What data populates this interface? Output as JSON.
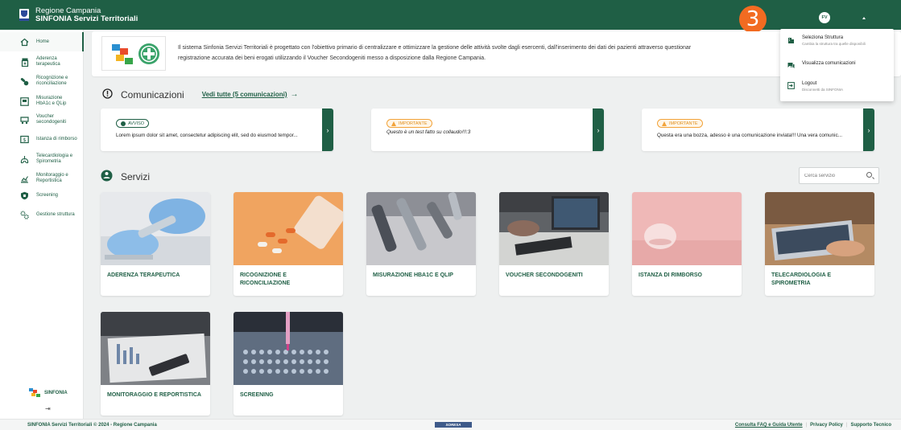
{
  "header": {
    "line1": "Regione Campania",
    "line2": "SINFONIA Servizi Territoriali",
    "step_number": "3",
    "avatar_initials": "FV"
  },
  "sidebar": {
    "items": [
      {
        "label": "Home",
        "icon": "home-icon"
      },
      {
        "label": "Aderenza terapeutica",
        "icon": "pill-bottle-icon"
      },
      {
        "label": "Ricognizione e riconciliazione",
        "icon": "pills-icon"
      },
      {
        "label": "Misurazione HbA1c e QLip",
        "icon": "meter-icon"
      },
      {
        "label": "Voucher secondogeniti",
        "icon": "stroller-icon"
      },
      {
        "label": "Istanza di rimborso",
        "icon": "money-icon"
      },
      {
        "label": "Telecardiologia e Spirometria",
        "icon": "lungs-icon"
      },
      {
        "label": "Monitoraggio e Reportistica",
        "icon": "chart-icon"
      },
      {
        "label": "Screening",
        "icon": "shield-icon"
      },
      {
        "label": "Gestione struttura",
        "icon": "gears-icon"
      }
    ],
    "logo_text": "SINFONIA",
    "collapse_icon": "collapse-icon"
  },
  "intro": {
    "text": "Il sistema Sinfonia Servizi Territoriali è progettato con l'obiettivo primario di centralizzare e ottimizzare la gestione delle attività svolte dagli esercenti, dall'inserimento dei dati dei pazienti attraverso questionar",
    "text2": "registrazione accurata dei beni erogati utilizzando il Voucher Secondogeniti messo a disposizione dalla Regione Campania."
  },
  "communications": {
    "title": "Comunicazioni",
    "see_all": "Vedi tutte (5 comunicazioni)",
    "cards": [
      {
        "badge": "AVVISO",
        "text": "Lorem ipsum dolor sit amet, consectetur adipiscing elit, sed do eiusmod tempor..."
      },
      {
        "badge": "IMPORTANTE",
        "text": "Questo è un test fatto su collaudo!!!:3"
      },
      {
        "badge": "IMPORTANTE",
        "text": "Questa era una bozza, adesso è una comunicazione inviata!!! Una vera comunic..."
      }
    ]
  },
  "services": {
    "title": "Servizi",
    "search_placeholder": "Cerca servizio",
    "cards": [
      {
        "label": "ADERENZA TERAPEUTICA"
      },
      {
        "label": "RICOGNIZIONE E RICONCILIAZIONE"
      },
      {
        "label": "MISURAZIONE HBA1C E QLIP"
      },
      {
        "label": "VOUCHER SECONDOGENITI"
      },
      {
        "label": "ISTANZA DI RIMBORSO"
      },
      {
        "label": "TELECARDIOLOGIA E SPIROMETRIA"
      },
      {
        "label": "MONITORAGGIO E REPORTISTICA"
      },
      {
        "label": "SCREENING"
      }
    ]
  },
  "user_menu": {
    "items": [
      {
        "title": "Seleziona Struttura",
        "subtitle": "Cambia la struttura tra quelle disponibili"
      },
      {
        "title": "Visualizza comunicazioni",
        "subtitle": ""
      },
      {
        "title": "Logout",
        "subtitle": "Disconnetti da SINFONIA"
      }
    ]
  },
  "footer": {
    "left": "SINFONIA Servizi Territoriali © 2024 - Regione Campania",
    "center_logo": "SORESA",
    "links": [
      "Consulta FAQ e Guida Utente",
      "Privacy Policy",
      "Supporto Tecnico"
    ]
  },
  "colors": {
    "primary": "#1f5f45",
    "accent_badge": "#f26b21",
    "important": "#f2a33a"
  }
}
